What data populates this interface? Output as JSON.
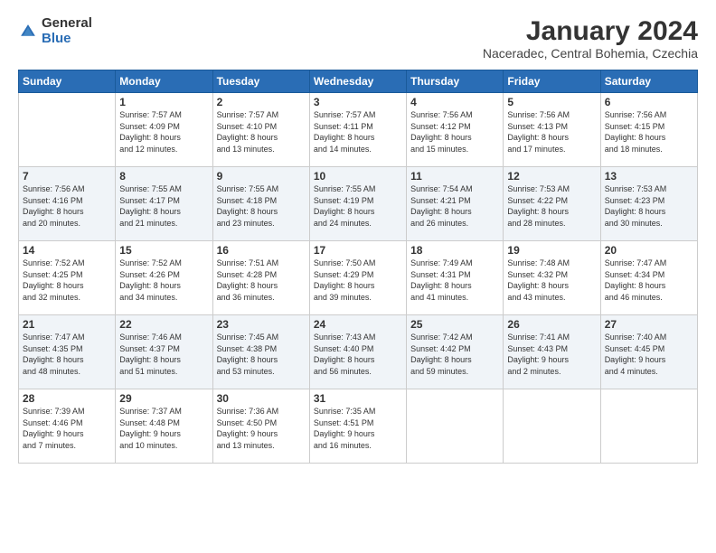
{
  "logo": {
    "general": "General",
    "blue": "Blue"
  },
  "header": {
    "month": "January 2024",
    "location": "Naceradec, Central Bohemia, Czechia"
  },
  "weekdays": [
    "Sunday",
    "Monday",
    "Tuesday",
    "Wednesday",
    "Thursday",
    "Friday",
    "Saturday"
  ],
  "weeks": [
    [
      {
        "day": "",
        "info": ""
      },
      {
        "day": "1",
        "info": "Sunrise: 7:57 AM\nSunset: 4:09 PM\nDaylight: 8 hours\nand 12 minutes."
      },
      {
        "day": "2",
        "info": "Sunrise: 7:57 AM\nSunset: 4:10 PM\nDaylight: 8 hours\nand 13 minutes."
      },
      {
        "day": "3",
        "info": "Sunrise: 7:57 AM\nSunset: 4:11 PM\nDaylight: 8 hours\nand 14 minutes."
      },
      {
        "day": "4",
        "info": "Sunrise: 7:56 AM\nSunset: 4:12 PM\nDaylight: 8 hours\nand 15 minutes."
      },
      {
        "day": "5",
        "info": "Sunrise: 7:56 AM\nSunset: 4:13 PM\nDaylight: 8 hours\nand 17 minutes."
      },
      {
        "day": "6",
        "info": "Sunrise: 7:56 AM\nSunset: 4:15 PM\nDaylight: 8 hours\nand 18 minutes."
      }
    ],
    [
      {
        "day": "7",
        "info": "Sunrise: 7:56 AM\nSunset: 4:16 PM\nDaylight: 8 hours\nand 20 minutes."
      },
      {
        "day": "8",
        "info": "Sunrise: 7:55 AM\nSunset: 4:17 PM\nDaylight: 8 hours\nand 21 minutes."
      },
      {
        "day": "9",
        "info": "Sunrise: 7:55 AM\nSunset: 4:18 PM\nDaylight: 8 hours\nand 23 minutes."
      },
      {
        "day": "10",
        "info": "Sunrise: 7:55 AM\nSunset: 4:19 PM\nDaylight: 8 hours\nand 24 minutes."
      },
      {
        "day": "11",
        "info": "Sunrise: 7:54 AM\nSunset: 4:21 PM\nDaylight: 8 hours\nand 26 minutes."
      },
      {
        "day": "12",
        "info": "Sunrise: 7:53 AM\nSunset: 4:22 PM\nDaylight: 8 hours\nand 28 minutes."
      },
      {
        "day": "13",
        "info": "Sunrise: 7:53 AM\nSunset: 4:23 PM\nDaylight: 8 hours\nand 30 minutes."
      }
    ],
    [
      {
        "day": "14",
        "info": "Sunrise: 7:52 AM\nSunset: 4:25 PM\nDaylight: 8 hours\nand 32 minutes."
      },
      {
        "day": "15",
        "info": "Sunrise: 7:52 AM\nSunset: 4:26 PM\nDaylight: 8 hours\nand 34 minutes."
      },
      {
        "day": "16",
        "info": "Sunrise: 7:51 AM\nSunset: 4:28 PM\nDaylight: 8 hours\nand 36 minutes."
      },
      {
        "day": "17",
        "info": "Sunrise: 7:50 AM\nSunset: 4:29 PM\nDaylight: 8 hours\nand 39 minutes."
      },
      {
        "day": "18",
        "info": "Sunrise: 7:49 AM\nSunset: 4:31 PM\nDaylight: 8 hours\nand 41 minutes."
      },
      {
        "day": "19",
        "info": "Sunrise: 7:48 AM\nSunset: 4:32 PM\nDaylight: 8 hours\nand 43 minutes."
      },
      {
        "day": "20",
        "info": "Sunrise: 7:47 AM\nSunset: 4:34 PM\nDaylight: 8 hours\nand 46 minutes."
      }
    ],
    [
      {
        "day": "21",
        "info": "Sunrise: 7:47 AM\nSunset: 4:35 PM\nDaylight: 8 hours\nand 48 minutes."
      },
      {
        "day": "22",
        "info": "Sunrise: 7:46 AM\nSunset: 4:37 PM\nDaylight: 8 hours\nand 51 minutes."
      },
      {
        "day": "23",
        "info": "Sunrise: 7:45 AM\nSunset: 4:38 PM\nDaylight: 8 hours\nand 53 minutes."
      },
      {
        "day": "24",
        "info": "Sunrise: 7:43 AM\nSunset: 4:40 PM\nDaylight: 8 hours\nand 56 minutes."
      },
      {
        "day": "25",
        "info": "Sunrise: 7:42 AM\nSunset: 4:42 PM\nDaylight: 8 hours\nand 59 minutes."
      },
      {
        "day": "26",
        "info": "Sunrise: 7:41 AM\nSunset: 4:43 PM\nDaylight: 9 hours\nand 2 minutes."
      },
      {
        "day": "27",
        "info": "Sunrise: 7:40 AM\nSunset: 4:45 PM\nDaylight: 9 hours\nand 4 minutes."
      }
    ],
    [
      {
        "day": "28",
        "info": "Sunrise: 7:39 AM\nSunset: 4:46 PM\nDaylight: 9 hours\nand 7 minutes."
      },
      {
        "day": "29",
        "info": "Sunrise: 7:37 AM\nSunset: 4:48 PM\nDaylight: 9 hours\nand 10 minutes."
      },
      {
        "day": "30",
        "info": "Sunrise: 7:36 AM\nSunset: 4:50 PM\nDaylight: 9 hours\nand 13 minutes."
      },
      {
        "day": "31",
        "info": "Sunrise: 7:35 AM\nSunset: 4:51 PM\nDaylight: 9 hours\nand 16 minutes."
      },
      {
        "day": "",
        "info": ""
      },
      {
        "day": "",
        "info": ""
      },
      {
        "day": "",
        "info": ""
      }
    ]
  ]
}
